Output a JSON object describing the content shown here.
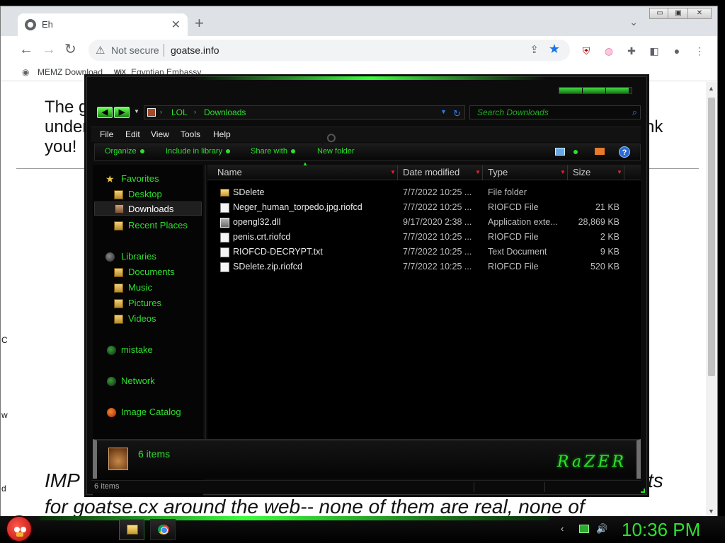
{
  "browser": {
    "tab_title": "Eh",
    "tab_close": "✕",
    "new_tab": "+",
    "tab_search": "⌄",
    "window_buttons": [
      "▭",
      "▣",
      "✕"
    ],
    "nav": {
      "back": "←",
      "forward": "→",
      "reload": "↻"
    },
    "security_icon": "⚠",
    "security_label": "Not secure",
    "url": "goatse.info",
    "bookmarks": [
      {
        "label": "MEMZ Download",
        "icon": "globe-icon"
      },
      {
        "label": "Egyptian Embassy",
        "icon": "wix-icon",
        "icon_text": "WiX"
      }
    ],
    "page_lines": [
      "The g",
      "under",
      "you!",
      "nk",
      "IMP",
      "ts",
      "for goatse.cx around the web-- none of them are real, none of"
    ],
    "edge_chars": [
      "C",
      "w",
      "d"
    ]
  },
  "explorer": {
    "breadcrumb": [
      "LOL",
      "Downloads"
    ],
    "search_placeholder": "Search Downloads",
    "menu": [
      "File",
      "Edit",
      "View",
      "Tools",
      "Help"
    ],
    "commands": [
      "Organize",
      "Include in library",
      "Share with",
      "New folder"
    ],
    "help_icon": "?",
    "navigation": {
      "favorites_header": "Favorites",
      "favorites": [
        "Desktop",
        "Downloads",
        "Recent Places"
      ],
      "selected": "Downloads",
      "libraries_header": "Libraries",
      "libraries": [
        "Documents",
        "Music",
        "Pictures",
        "Videos"
      ],
      "other": [
        "mistake",
        "Network",
        "Image Catalog"
      ]
    },
    "columns": [
      "Name",
      "Date modified",
      "Type",
      "Size"
    ],
    "files": [
      {
        "name": "SDelete",
        "date": "7/7/2022 10:25 ...",
        "type": "File folder",
        "size": "",
        "icon": "folder-icon"
      },
      {
        "name": "Neger_human_torpedo.jpg.riofcd",
        "date": "7/7/2022 10:25 ...",
        "type": "RIOFCD File",
        "size": "21 KB",
        "icon": "file-icon"
      },
      {
        "name": "opengl32.dll",
        "date": "9/17/2020 2:38 ...",
        "type": "Application exte...",
        "size": "28,869 KB",
        "icon": "dll-icon"
      },
      {
        "name": "penis.crt.riofcd",
        "date": "7/7/2022 10:25 ...",
        "type": "RIOFCD File",
        "size": "2 KB",
        "icon": "file-icon"
      },
      {
        "name": "RIOFCD-DECRYPT.txt",
        "date": "7/7/2022 10:25 ...",
        "type": "Text Document",
        "size": "9 KB",
        "icon": "text-file-icon"
      },
      {
        "name": "SDelete.zip.riofcd",
        "date": "7/7/2022 10:25 ...",
        "type": "RIOFCD File",
        "size": "520 KB",
        "icon": "file-icon"
      }
    ],
    "details_count": "6 items",
    "status_text": "6 items",
    "brand_logo": "RaZER"
  },
  "taskbar": {
    "clock": "10:36 PM",
    "tray": [
      "‹",
      "🔊"
    ]
  },
  "colors": {
    "accent_green": "#2ee02e",
    "chrome_blue": "#1a73e8"
  }
}
